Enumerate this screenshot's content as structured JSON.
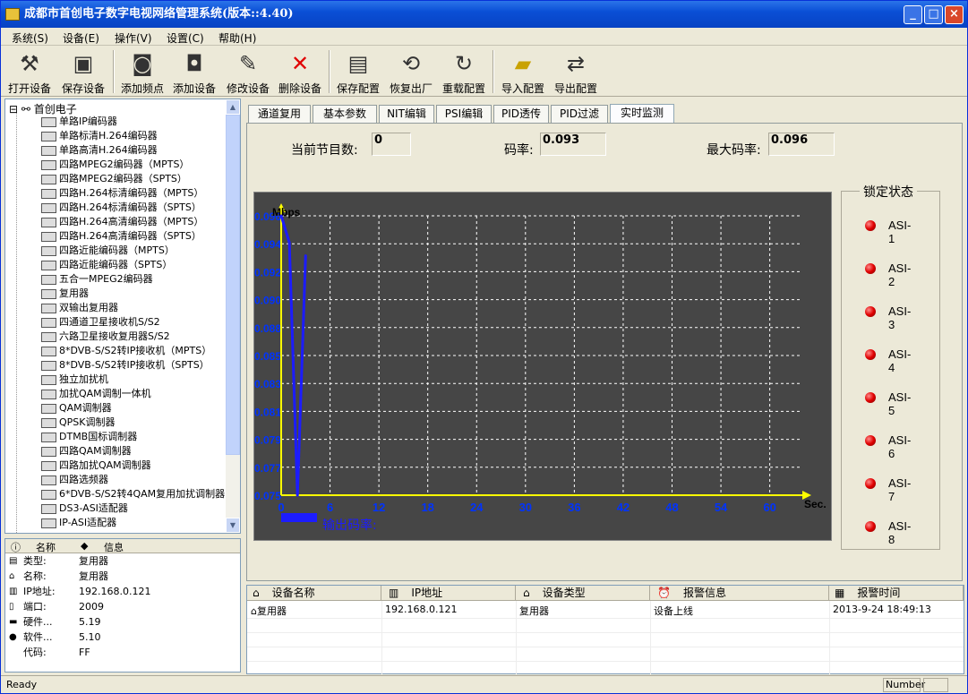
{
  "window": {
    "title": "成都市首创电子数字电视网络管理系统(版本::4.40)",
    "minimize": "_",
    "maximize": "□",
    "close": "×"
  },
  "menu": [
    "系统(S)",
    "设备(E)",
    "操作(V)",
    "设置(C)",
    "帮助(H)"
  ],
  "toolbar": [
    "打开设备",
    "保存设备",
    "添加频点",
    "添加设备",
    "修改设备",
    "删除设备",
    "保存配置",
    "恢复出厂",
    "重载配置",
    "导入配置",
    "导出配置"
  ],
  "tree": {
    "root": "首创电子",
    "items": [
      "单路IP编码器",
      "单路标清H.264编码器",
      "单路高清H.264编码器",
      "四路MPEG2编码器（MPTS）",
      "四路MPEG2编码器（SPTS）",
      "四路H.264标清编码器（MPTS）",
      "四路H.264标清编码器（SPTS）",
      "四路H.264高清编码器（MPTS）",
      "四路H.264高清编码器（SPTS）",
      "四路近能编码器（MPTS）",
      "四路近能编码器（SPTS）",
      "五合一MPEG2编码器",
      "复用器",
      "双输出复用器",
      "四通道卫星接收机S/S2",
      "六路卫星接收复用器S/S2",
      "8*DVB-S/S2转IP接收机（MPTS）",
      "8*DVB-S/S2转IP接收机（SPTS）",
      "独立加扰机",
      "加扰QAM调制一体机",
      "QAM调制器",
      "QPSK调制器",
      "DTMB国标调制器",
      "四路QAM调制器",
      "四路加扰QAM调制器",
      "四路选频器",
      "6*DVB-S/S2转4QAM复用加扰调制器",
      "DS3-ASI适配器",
      "IP-ASI适配器"
    ]
  },
  "props": {
    "col_name": "名称",
    "col_info": "信息",
    "rows": [
      {
        "k": "类型:",
        "v": "复用器"
      },
      {
        "k": "名称:",
        "v": "复用器"
      },
      {
        "k": "IP地址:",
        "v": "192.168.0.121"
      },
      {
        "k": "端口:",
        "v": "2009"
      },
      {
        "k": "硬件...",
        "v": "5.19"
      },
      {
        "k": "软件...",
        "v": "5.10"
      },
      {
        "k": "代码:",
        "v": "FF"
      }
    ]
  },
  "tabs": [
    "通道复用",
    "基本参数",
    "NIT编辑",
    "PSI编辑",
    "PID透传",
    "PID过滤",
    "实时监测"
  ],
  "monitor": {
    "prog_label": "当前节目数:",
    "prog_value": "0",
    "rate_label": "码率:",
    "rate_value": "0.093",
    "max_label": "最大码率:",
    "max_value": "0.096",
    "output_label": "输出码率:"
  },
  "lock": {
    "title": "锁定状态",
    "items": [
      "ASI-1",
      "ASI-2",
      "ASI-3",
      "ASI-4",
      "ASI-5",
      "ASI-6",
      "ASI-7",
      "ASI-8"
    ]
  },
  "chart_data": {
    "type": "line",
    "ylabel": "Mbps",
    "xlabel": "Sec.",
    "xticks": [
      "0",
      "6",
      "12",
      "18",
      "24",
      "30",
      "36",
      "42",
      "48",
      "54",
      "60"
    ],
    "yticks": [
      "0.096",
      "0.094",
      "0.092",
      "0.090",
      "0.088",
      "0.085",
      "0.083",
      "0.081",
      "0.079",
      "0.077",
      "0.075"
    ],
    "xlim": [
      0,
      64
    ],
    "ylim": [
      0.075,
      0.096
    ],
    "series": [
      {
        "values": [
          [
            0,
            0.096
          ],
          [
            1,
            0.094
          ],
          [
            2,
            0.075
          ],
          [
            3,
            0.093
          ]
        ]
      }
    ],
    "colors": {
      "axis": "#ffff00",
      "line": "#1c1cff",
      "ticks": "#0033ff",
      "grid": "#ffffff",
      "bg": "#464646"
    }
  },
  "alarm": {
    "headers": [
      "设备名称",
      "IP地址",
      "设备类型",
      "报警信息",
      "报警时间"
    ],
    "rows": [
      [
        "复用器",
        "192.168.0.121",
        "复用器",
        "设备上线",
        "2013-9-24 18:49:13"
      ]
    ]
  },
  "status": {
    "ready": "Ready",
    "number": "Number"
  }
}
